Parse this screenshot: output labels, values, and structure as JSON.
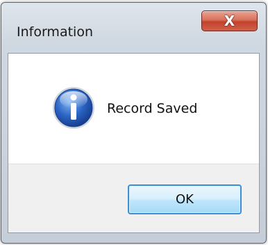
{
  "dialog": {
    "title": "Information",
    "message": "Record Saved",
    "ok_label": "OK",
    "close_glyph": "X",
    "icon": "information-icon"
  },
  "colors": {
    "close_button": "#c4422c",
    "ok_border": "#3c8fd6",
    "button_area": "#f0f0f0"
  }
}
